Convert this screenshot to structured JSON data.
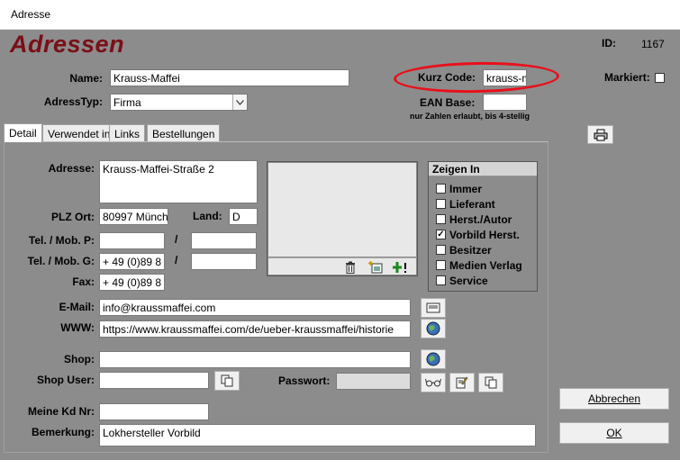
{
  "window": {
    "title": "Adresse"
  },
  "header": {
    "heading": "Adressen",
    "id_label": "ID:",
    "id_value": "1167",
    "markiert_label": "Markiert:"
  },
  "fields": {
    "name_label": "Name:",
    "name_value": "Krauss-Maffei",
    "adresstyp_label": "AdressTyp:",
    "adresstyp_value": "Firma",
    "kurzcode_label": "Kurz Code:",
    "kurzcode_value": "krauss-m",
    "ean_label": "EAN Base:",
    "ean_value": "",
    "ean_hint": "nur Zahlen erlaubt, bis 4-stellig"
  },
  "tabs": [
    "Detail",
    "Verwendet in",
    "Links",
    "Bestellungen"
  ],
  "detail": {
    "adresse_label": "Adresse:",
    "adresse_value": "Krauss-Maffei-Straße 2",
    "plz_label": "PLZ Ort:",
    "plz_value": "80997 Münch",
    "land_label": "Land:",
    "land_value": "D",
    "telp_label": "Tel. / Mob. P:",
    "telp_value1": "",
    "telp_value2": "",
    "telg_label": "Tel. / Mob. G:",
    "telg_value1": "+ 49 (0)89 8",
    "telg_value2": "",
    "slash": "/",
    "fax_label": "Fax:",
    "fax_value": "+ 49 (0)89 8",
    "email_label": "E-Mail:",
    "email_value": "info@kraussmaffei.com",
    "www_label": "WWW:",
    "www_value": "https://www.kraussmaffei.com/de/ueber-kraussmaffei/historie",
    "shop_label": "Shop:",
    "shop_value": "",
    "shopuser_label": "Shop User:",
    "shopuser_value": "",
    "passwort_label": "Passwort:",
    "passwort_value": "",
    "kdnr_label": "Meine Kd Nr:",
    "kdnr_value": "",
    "bemerkung_label": "Bemerkung:",
    "bemerkung_value": "Lokhersteller Vorbild"
  },
  "zeigen": {
    "title": "Zeigen In",
    "items": [
      {
        "label": "Immer",
        "checked": false
      },
      {
        "label": "Lieferant",
        "checked": false
      },
      {
        "label": "Herst./Autor",
        "checked": false
      },
      {
        "label": "Vorbild Herst.",
        "checked": true
      },
      {
        "label": "Besitzer",
        "checked": false
      },
      {
        "label": "Medien Verlag",
        "checked": false
      },
      {
        "label": "Service",
        "checked": false
      }
    ]
  },
  "buttons": {
    "abbrechen": "Abbrechen",
    "ok": "OK"
  },
  "icons": {
    "print": "printer-icon",
    "delete": "trash-icon",
    "new_image": "new-image-icon",
    "add": "plus-icon",
    "email": "envelope-icon",
    "globe": "globe-icon",
    "copy": "copy-icon",
    "glasses": "glasses-icon",
    "edit": "edit-icon"
  },
  "colors": {
    "heading": "#7a0f17",
    "form_bg": "#8c8c8c",
    "annotation": "#e8101a"
  }
}
